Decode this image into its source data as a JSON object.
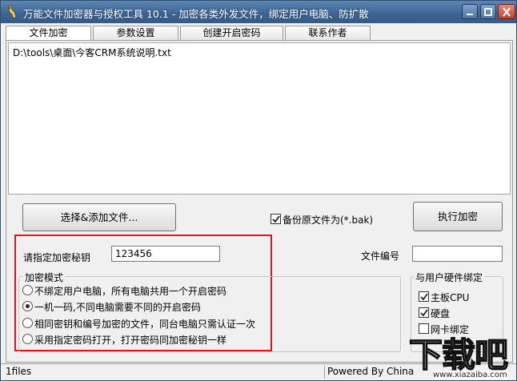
{
  "window": {
    "title": "万能文件加密器与授权工具 10.1 - 加密各类外发文件，绑定用户电脑、防扩散",
    "icon": "key-app-icon",
    "controls": [
      "minimize-icon",
      "maximize-icon",
      "close-icon"
    ]
  },
  "tabs": [
    {
      "label": "文件加密",
      "active": true
    },
    {
      "label": "参数设置",
      "active": false
    },
    {
      "label": "创建开启密码",
      "active": false
    },
    {
      "label": "联系作者",
      "active": false
    }
  ],
  "file_list": {
    "items": [
      "D:\\tools\\桌面\\今客CRM系统说明.txt"
    ]
  },
  "buttons": {
    "select_files": "选择&添加文件...",
    "execute_encrypt": "执行加密"
  },
  "backup": {
    "label": "备份原文件为(*.bak)",
    "checked": true
  },
  "key_field": {
    "label": "请指定加密秘钥",
    "value": "123456"
  },
  "file_no": {
    "label": "文件编号",
    "value": ""
  },
  "encrypt_mode": {
    "title": "加密模式",
    "options": [
      {
        "label": "不绑定用户电脑，所有电脑共用一个开启密码",
        "selected": false
      },
      {
        "label": "一机一码,不同电脑需要不同的开启密码",
        "selected": true
      },
      {
        "label": "相同密钥和编号加密的文件，同台电脑只需认证一次",
        "selected": false
      },
      {
        "label": "采用指定密码打开，打开密码同加密秘钥一样",
        "selected": false
      }
    ]
  },
  "hardware_binding": {
    "title": "与用户硬件绑定",
    "options": [
      {
        "label": "主板CPU",
        "checked": true
      },
      {
        "label": "硬盘",
        "checked": true
      },
      {
        "label": "网卡绑定",
        "checked": false
      }
    ]
  },
  "status_bar": {
    "file_count": "1files",
    "powered_by": "Powered By China"
  },
  "watermark": {
    "logo_text": "下载吧",
    "url": "www.xiazaiba.com"
  },
  "colors": {
    "titlebar": "#3f6796",
    "highlight_border": "#e3141b",
    "window_bg": "#f0f0f0"
  }
}
